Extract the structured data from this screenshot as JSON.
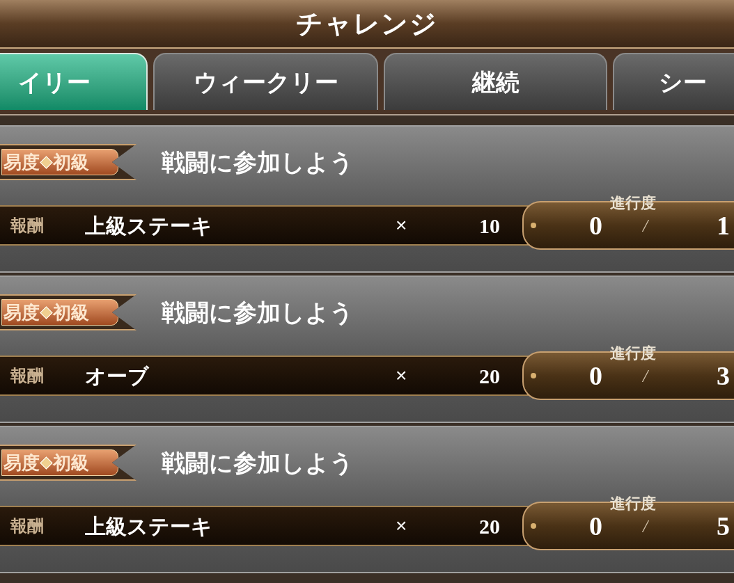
{
  "title": "チャレンジ",
  "tabs": [
    {
      "label": "イリー",
      "selected": true
    },
    {
      "label": "ウィークリー",
      "selected": false
    },
    {
      "label": "継続",
      "selected": false
    },
    {
      "label": "シー",
      "selected": false
    }
  ],
  "challenges": [
    {
      "difficulty_label": "易度",
      "difficulty": "初級",
      "title": "戦闘に参加しよう",
      "reward_label": "報酬",
      "reward_item": "上級ステーキ",
      "times": "×",
      "quantity": "10",
      "progress_label": "進行度",
      "progress_current": "0",
      "slash": "/",
      "progress_target": "1"
    },
    {
      "difficulty_label": "易度",
      "difficulty": "初級",
      "title": "戦闘に参加しよう",
      "reward_label": "報酬",
      "reward_item": "オーブ",
      "times": "×",
      "quantity": "20",
      "progress_label": "進行度",
      "progress_current": "0",
      "slash": "/",
      "progress_target": "3"
    },
    {
      "difficulty_label": "易度",
      "difficulty": "初級",
      "title": "戦闘に参加しよう",
      "reward_label": "報酬",
      "reward_item": "上級ステーキ",
      "times": "×",
      "quantity": "20",
      "progress_label": "進行度",
      "progress_current": "0",
      "slash": "/",
      "progress_target": "5"
    }
  ]
}
